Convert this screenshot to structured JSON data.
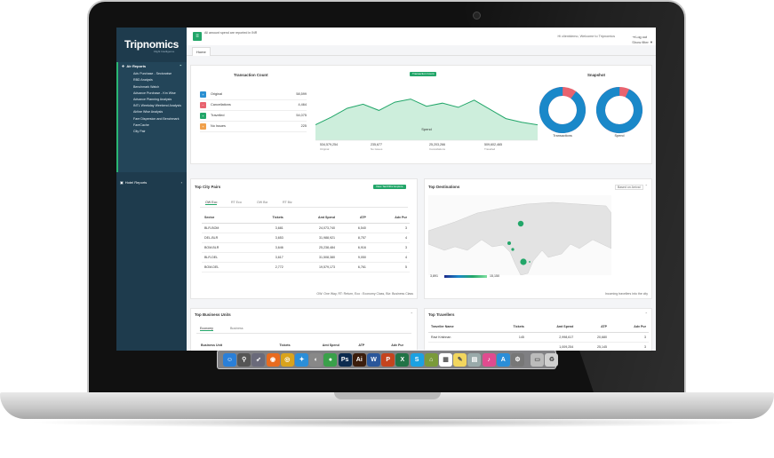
{
  "app": {
    "logo": "Tripnomics",
    "logo_sub": "Flight Intelligence",
    "note": "All amount spend are reported in INR",
    "welcome": "Hi clientdemo, Welcome to Tripnomics",
    "logout": "Log out",
    "tab_home": "Home",
    "show_filter": "Show filter"
  },
  "sidebar": {
    "section_air": "Air Reports",
    "items": [
      "Adv Purchase - Sectorwise",
      "RBD Analysis",
      "Benchmark Watch",
      "Advance Purchase - Km Wise",
      "Advance Planning Analysis",
      "INTL Weekday Weekend Analysis",
      "Airline Wise Analysis",
      "Fare Dispersion and Benchmark",
      "FareCache",
      "City Pair"
    ],
    "section_hotel": "Hotel Reports"
  },
  "transaction": {
    "title": "Transaction Count",
    "rows": [
      {
        "label": "Original",
        "value": "58,599",
        "color": "#2a8fd1",
        "icon": "plus"
      },
      {
        "label": "Cancellations",
        "value": "4,464",
        "color": "#e8636f",
        "icon": "minus"
      },
      {
        "label": "Travelled",
        "value": "54,075",
        "color": "#22a669",
        "icon": "plus"
      },
      {
        "label": "No Issues",
        "value": "225",
        "color": "#f0a04b",
        "icon": "plus"
      }
    ],
    "pill": "Transaction Count",
    "spend_label": "Spend"
  },
  "chart_data": {
    "type": "area",
    "title": "",
    "categories": [
      "Original",
      "Cancellations",
      "Travelled"
    ],
    "x_labels": [
      "Original",
      "No Issues",
      "Cancellations",
      "Travelled"
    ],
    "x_values": [
      534579254,
      235677,
      25203266,
      509602465
    ],
    "x_value_labels": [
      "534,579,254",
      "235,677",
      "25,203,266",
      "509,602,465"
    ],
    "series": [
      {
        "values": [
          30,
          45,
          62,
          70,
          58,
          74,
          80,
          66,
          72,
          64,
          78,
          60,
          42,
          35,
          30
        ]
      }
    ],
    "color": "#22a669",
    "ylim": [
      0,
      100
    ],
    "xlabel": "Spend"
  },
  "snapshot": {
    "title": "Snapshot",
    "donuts": [
      {
        "label": "Transactions",
        "fraction": 0.9,
        "color": "#1a88c9",
        "rest": "#e8636f"
      },
      {
        "label": "Spend",
        "fraction": 0.93,
        "color": "#1a88c9",
        "rest": "#e8636f"
      }
    ]
  },
  "city_pairs": {
    "title": "Top City Pairs",
    "button": "View Tarrif/Rnr Explore",
    "tabs": [
      "OW Eco",
      "RT Eco",
      "OW Biz",
      "RT Biz"
    ],
    "columns": [
      "Sector",
      "Tickets",
      "Amt Spend",
      "ATP",
      "Adv Pur"
    ],
    "rows": [
      [
        "BLR-BOM",
        "3,681",
        "24,073,740",
        "6,540",
        "3"
      ],
      [
        "DEL-BLR",
        "3,653",
        "31,988,921",
        "8,757",
        "4"
      ],
      [
        "BOM-BLR",
        "3,646",
        "25,238,484",
        "6,916",
        "3"
      ],
      [
        "BLR-DEL",
        "3,617",
        "31,508,380",
        "9,050",
        "4"
      ],
      [
        "BOM-DEL",
        "2,772",
        "19,579,173",
        "6,761",
        "5"
      ]
    ],
    "footnote": "OW: One Way, RT: Return, Eco : Economy Class, Biz: Business Class"
  },
  "destinations": {
    "title": "Top Destinations",
    "dropdown": "Based on Arrival",
    "legend_min": "3,891",
    "legend_max": "15,150",
    "footnote": "Incoming travellers into the city"
  },
  "business_units": {
    "title": "Top Business Units",
    "tabs": [
      "Economy",
      "Business"
    ],
    "columns": [
      "Business Unit",
      "Tickets",
      "Amt Spend",
      "ATP",
      "Adv Pur"
    ]
  },
  "travellers": {
    "title": "Top Travellers",
    "columns": [
      "Traveller Name",
      "Tickets",
      "Amt Spend",
      "ATP",
      "Adv Pur"
    ],
    "rows": [
      [
        "Ravi Krishnan",
        "145",
        "2,998,617",
        "20,680",
        "3"
      ],
      [
        "",
        "",
        "1,009,254",
        "25,145",
        "3"
      ]
    ]
  }
}
